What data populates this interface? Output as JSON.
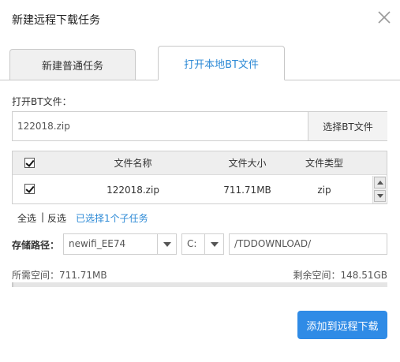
{
  "window": {
    "title": "新建远程下载任务"
  },
  "tabs": [
    {
      "label": "新建普通任务",
      "active": false
    },
    {
      "label": "打开本地BT文件",
      "active": true
    }
  ],
  "bt": {
    "label": "打开BT文件：",
    "file_value": "122018.zip",
    "choose_button": "选择BT文件"
  },
  "table": {
    "headers": {
      "name": "文件名称",
      "size": "文件大小",
      "type": "文件类型"
    },
    "rows": [
      {
        "checked": true,
        "name": "122018.zip",
        "size": "711.71MB",
        "type": "zip"
      }
    ]
  },
  "selection": {
    "select_all": "全选",
    "separator": "|",
    "invert": "反选",
    "selected_count": "已选择1个子任务"
  },
  "storage": {
    "label": "存储路径：",
    "device": "newifi_EE74",
    "drive": "C:",
    "path": "/TDDOWNLOAD/"
  },
  "space": {
    "required": "所需空间：711.71MB",
    "remaining": "剩余空间：148.51GB",
    "used_fraction": 0.005
  },
  "actions": {
    "submit": "添加到远程下载"
  },
  "colors": {
    "accent": "#2f8be6",
    "link": "#2d8ad6"
  }
}
